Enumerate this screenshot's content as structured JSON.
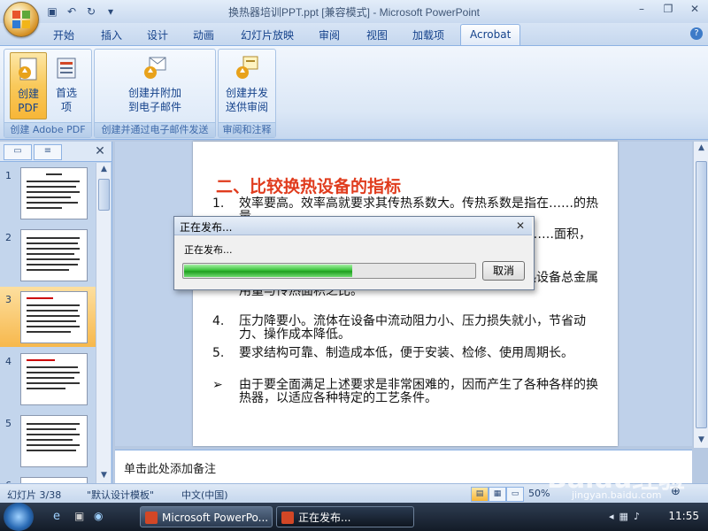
{
  "window": {
    "title": "换热器培训PPT.ppt [兼容模式] - Microsoft PowerPoint"
  },
  "ribbon_tabs": [
    "开始",
    "插入",
    "设计",
    "动画",
    "幻灯片放映",
    "审阅",
    "视图",
    "加载项",
    "Acrobat"
  ],
  "active_tab": "Acrobat",
  "ribbon": {
    "groups": [
      {
        "label": "创建 Adobe PDF",
        "buttons": [
          {
            "label_1": "创建",
            "label_2": "PDF"
          },
          {
            "label_1": "首选",
            "label_2": "项"
          }
        ]
      },
      {
        "label": "创建并通过电子邮件发送",
        "buttons": [
          {
            "label_1": "创建并附加",
            "label_2": "到电子邮件"
          }
        ]
      },
      {
        "label": "审阅和注释",
        "buttons": [
          {
            "label_1": "创建并发",
            "label_2": "送供审阅"
          }
        ]
      }
    ]
  },
  "thumbnails": [
    "1",
    "2",
    "3",
    "4",
    "5",
    "6"
  ],
  "selected_slide": 3,
  "slide": {
    "title": "二、比较换热设备的指标",
    "bullets": [
      {
        "marker": "1.",
        "text": "效率要高。效率高就要求其传热系数大。传热系数是指在……的热量。"
      },
      {
        "marker": "",
        "text": "……表面积大，……面积，即"
      },
      {
        "marker": "",
        "text": "……比重量是指单位传热面积所耗用的金属量，即换热设备总金属用量与传热面积之比。"
      },
      {
        "marker": "4.",
        "text": "压力降要小。流体在设备中流动阻力小、压力损失就小，节省动力、操作成本降低。"
      },
      {
        "marker": "5.",
        "text": "要求结构可靠、制造成本低，便于安装、检修、使用周期长。"
      },
      {
        "marker": "➢",
        "text": "由于要全面满足上述要求是非常困难的，因而产生了各种各样的换热器，以适应各种特定的工艺条件。"
      }
    ]
  },
  "notes": {
    "placeholder": "单击此处添加备注"
  },
  "status": {
    "slide_info": "幻灯片 3/38",
    "theme": "\"默认设计模板\"",
    "language": "中文(中国)",
    "zoom": "50%"
  },
  "dialog": {
    "title": "正在发布...",
    "message": "正在发布...",
    "cancel_label": "取消",
    "progress_fraction": 0.58
  },
  "taskbar": {
    "items": [
      "Microsoft PowerPo...",
      "正在发布..."
    ],
    "clock": "11:55"
  },
  "watermark": {
    "brand": "Baidu经验",
    "url": "jingyan.baidu.com"
  },
  "colors": {
    "slide_title": "#e03c1e",
    "progress": "#3bc23b",
    "selection": "#f7b84c"
  },
  "icons": {
    "office_button": "office-logo",
    "save": "save-icon",
    "undo": "undo-icon",
    "redo": "redo-icon",
    "help": "help-icon"
  }
}
